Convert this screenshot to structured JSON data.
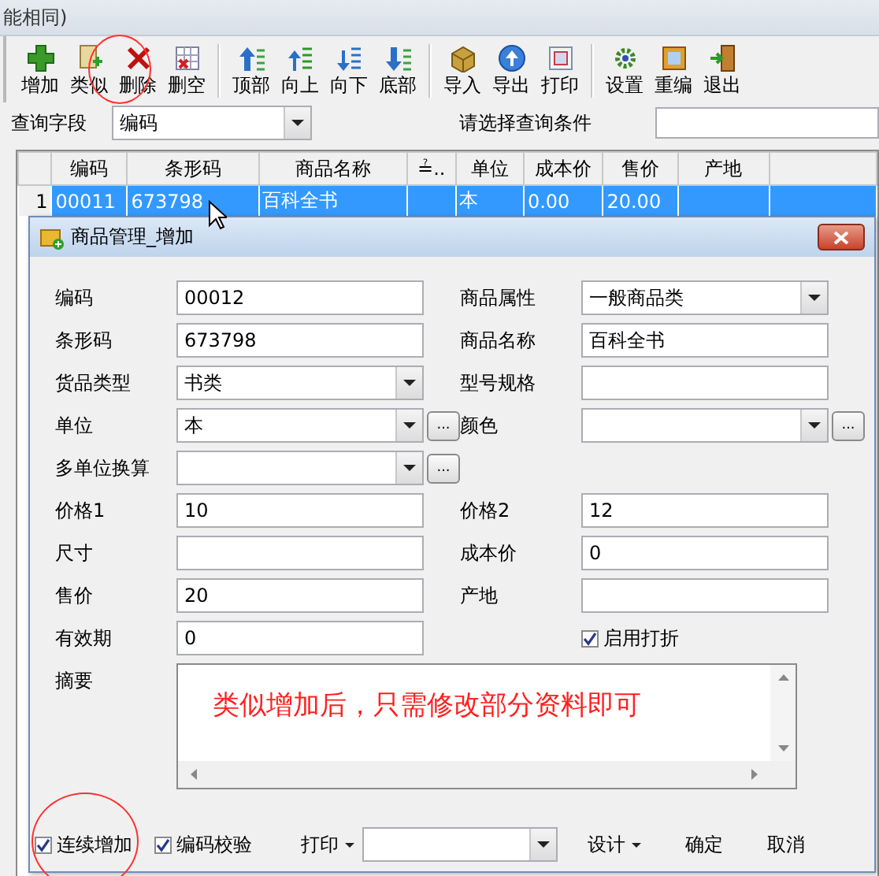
{
  "window": {
    "title": "能相同)"
  },
  "toolbar_groups": [
    [
      {
        "label": "增加"
      },
      {
        "label": "类似"
      },
      {
        "label": "删除"
      },
      {
        "label": "删空"
      }
    ],
    [
      {
        "label": "顶部"
      },
      {
        "label": "向上"
      },
      {
        "label": "向下"
      },
      {
        "label": "底部"
      }
    ],
    [
      {
        "label": "导入"
      },
      {
        "label": "导出"
      },
      {
        "label": "打印"
      }
    ],
    [
      {
        "label": "设置"
      },
      {
        "label": "重编"
      },
      {
        "label": "退出"
      }
    ]
  ],
  "query": {
    "field_label": "查询字段",
    "field_value": "编码",
    "condition_label": "请选择查询条件"
  },
  "table": {
    "columns": [
      {
        "label": "编码"
      },
      {
        "label": "条形码"
      },
      {
        "label": "商品名称"
      },
      {
        "label": "≟.."
      },
      {
        "label": "单位"
      },
      {
        "label": "成本价"
      },
      {
        "label": "售价"
      },
      {
        "label": "产地"
      }
    ],
    "rows": [
      {
        "number": "1",
        "selected": true,
        "cells": [
          "00011",
          "673798",
          "百科全书",
          null,
          "本",
          "0.00",
          "20.00",
          null
        ]
      }
    ]
  },
  "dialog": {
    "title": "商品管理_增加",
    "rows": [
      [
        {
          "kind": "text",
          "label": "编码",
          "value": "00012"
        },
        {
          "kind": "combo",
          "label": "商品属性",
          "value": "一般商品类"
        }
      ],
      [
        {
          "kind": "text",
          "label": "条形码",
          "value": "673798"
        },
        {
          "kind": "text",
          "label": "商品名称",
          "value": "百科全书"
        }
      ],
      [
        {
          "kind": "combo",
          "label": "货品类型",
          "value": "书类"
        },
        {
          "kind": "text",
          "label": "型号规格"
        }
      ],
      [
        {
          "kind": "combo",
          "label": "单位",
          "value": "本",
          "ellipsis": "..."
        },
        {
          "kind": "combo",
          "label": "颜色",
          "ellipsis": "..."
        }
      ],
      [
        {
          "kind": "combo",
          "label": "多单位换算",
          "ellipsis": "..."
        }
      ],
      [
        {
          "kind": "text",
          "label": "价格1",
          "value": "10"
        },
        {
          "kind": "text",
          "label": "价格2",
          "value": "12"
        }
      ],
      [
        {
          "kind": "text",
          "label": "尺寸"
        },
        {
          "kind": "text",
          "label": "成本价",
          "value": "0"
        }
      ],
      [
        {
          "kind": "text",
          "label": "售价",
          "value": "20"
        },
        {
          "kind": "text",
          "label": "产地"
        }
      ],
      [
        {
          "kind": "text",
          "label": "有效期",
          "value": "0"
        },
        {
          "kind": "checkbox",
          "label": "启用打折",
          "checked": true
        }
      ]
    ],
    "memo": {
      "label": "摘要",
      "value": "类似增加后，只需修改部分资料即可"
    },
    "footer": {
      "checkboxes": [
        {
          "label": "连续增加",
          "checked": true
        },
        {
          "label": "编码校验",
          "checked": true
        }
      ],
      "print_label": "打印",
      "design_label": "设计",
      "ok_label": "确定",
      "cancel_label": "取消"
    }
  }
}
